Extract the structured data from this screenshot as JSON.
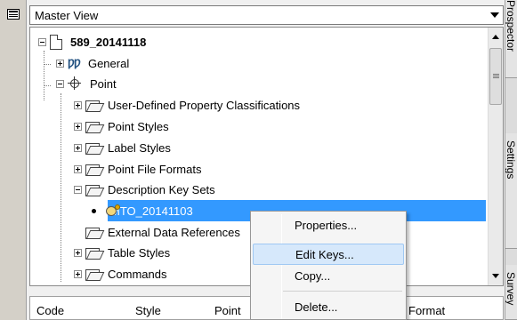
{
  "header": {
    "view_selector_value": "Master View"
  },
  "tree": {
    "root": "589_20141118",
    "general": "General",
    "general_icon_text": "ǷǷ",
    "point": "Point",
    "point_children": [
      "User-Defined Property Classifications",
      "Point Styles",
      "Label Styles",
      "Point File Formats",
      "Description Key Sets",
      "MTO_20141103",
      "External Data References",
      "Table Styles",
      "Commands"
    ]
  },
  "context_menu": {
    "items": [
      "Properties...",
      "Edit Keys...",
      "Copy...",
      "Delete..."
    ],
    "highlighted": "Edit Keys..."
  },
  "grid": {
    "columns": [
      "Code",
      "Style",
      "Point",
      "Format"
    ]
  },
  "right_tabs": [
    "Prospector",
    "Settings",
    "Survey"
  ],
  "icons": {
    "collapse": "minus-box-icon",
    "expand": "plus-box-icon",
    "folder": "folder-icon",
    "point": "point-crosshair-icon",
    "key_set": "key-set-icon"
  },
  "colors": {
    "selection": "#3399ff",
    "menu_highlight": "#d6e8fb"
  }
}
